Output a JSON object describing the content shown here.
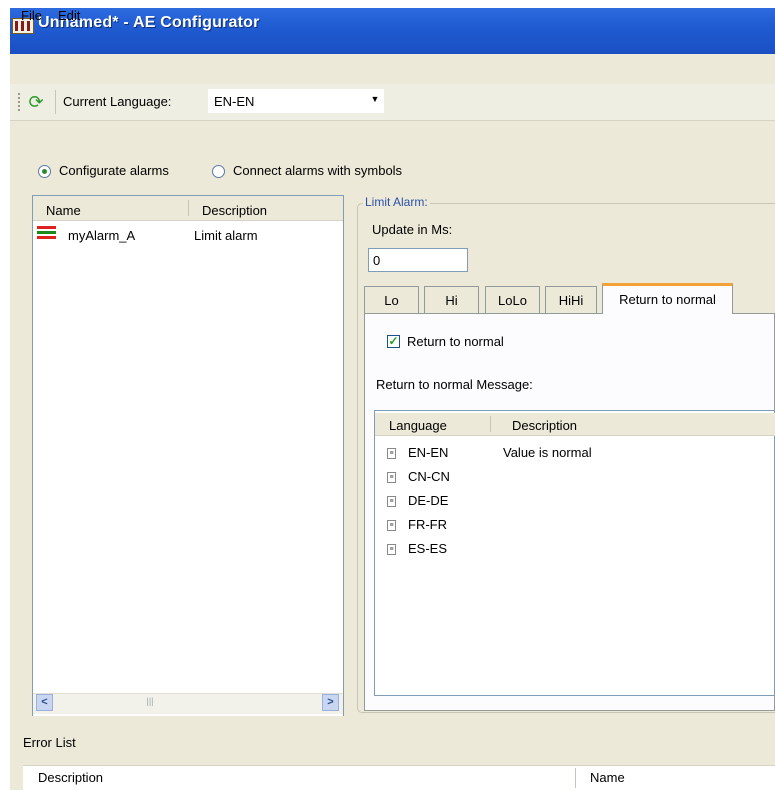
{
  "window": {
    "title": "Unnamed* - AE Configurator",
    "app_icon": "ae-configurator-icon"
  },
  "menu": {
    "items": [
      {
        "label": "File"
      },
      {
        "label": "Edit"
      }
    ]
  },
  "toolbar": {
    "refresh_icon": "refresh-icon",
    "language_label": "Current Language:",
    "language_value": "EN-EN"
  },
  "mode": {
    "options": [
      {
        "label": "Configurate alarms",
        "selected": true
      },
      {
        "label": "Connect alarms with symbols",
        "selected": false
      }
    ]
  },
  "alarm_list": {
    "columns": [
      "Name",
      "Description"
    ],
    "rows": [
      {
        "name": "myAlarm_A",
        "description": "Limit alarm",
        "icon": "alarm-limit-icon"
      }
    ]
  },
  "limit_alarm": {
    "group_title": "Limit Alarm:",
    "update_label": "Update in Ms:",
    "update_value": "0",
    "tabs": [
      {
        "label": "Lo",
        "active": false
      },
      {
        "label": "Hi",
        "active": false
      },
      {
        "label": "LoLo",
        "active": false
      },
      {
        "label": "HiHi",
        "active": false
      },
      {
        "label": "Return to normal",
        "active": true
      }
    ],
    "return_to_normal": {
      "checkbox_label": "Return to normal",
      "checked": true,
      "message_label": "Return to normal Message:",
      "columns": [
        "Language",
        "Description"
      ],
      "rows": [
        {
          "language": "EN-EN",
          "description": "Value is normal"
        },
        {
          "language": "CN-CN",
          "description": ""
        },
        {
          "language": "DE-DE",
          "description": ""
        },
        {
          "language": "FR-FR",
          "description": ""
        },
        {
          "language": "ES-ES",
          "description": ""
        }
      ]
    }
  },
  "error_list": {
    "title": "Error List",
    "columns": [
      "Description",
      "Name"
    ]
  },
  "colors": {
    "titlebar": "#1f5ad0",
    "panel": "#ece9d8",
    "active_tab_accent": "#f3a23a",
    "check_green": "#21a121",
    "legend_blue": "#2a52a8"
  }
}
